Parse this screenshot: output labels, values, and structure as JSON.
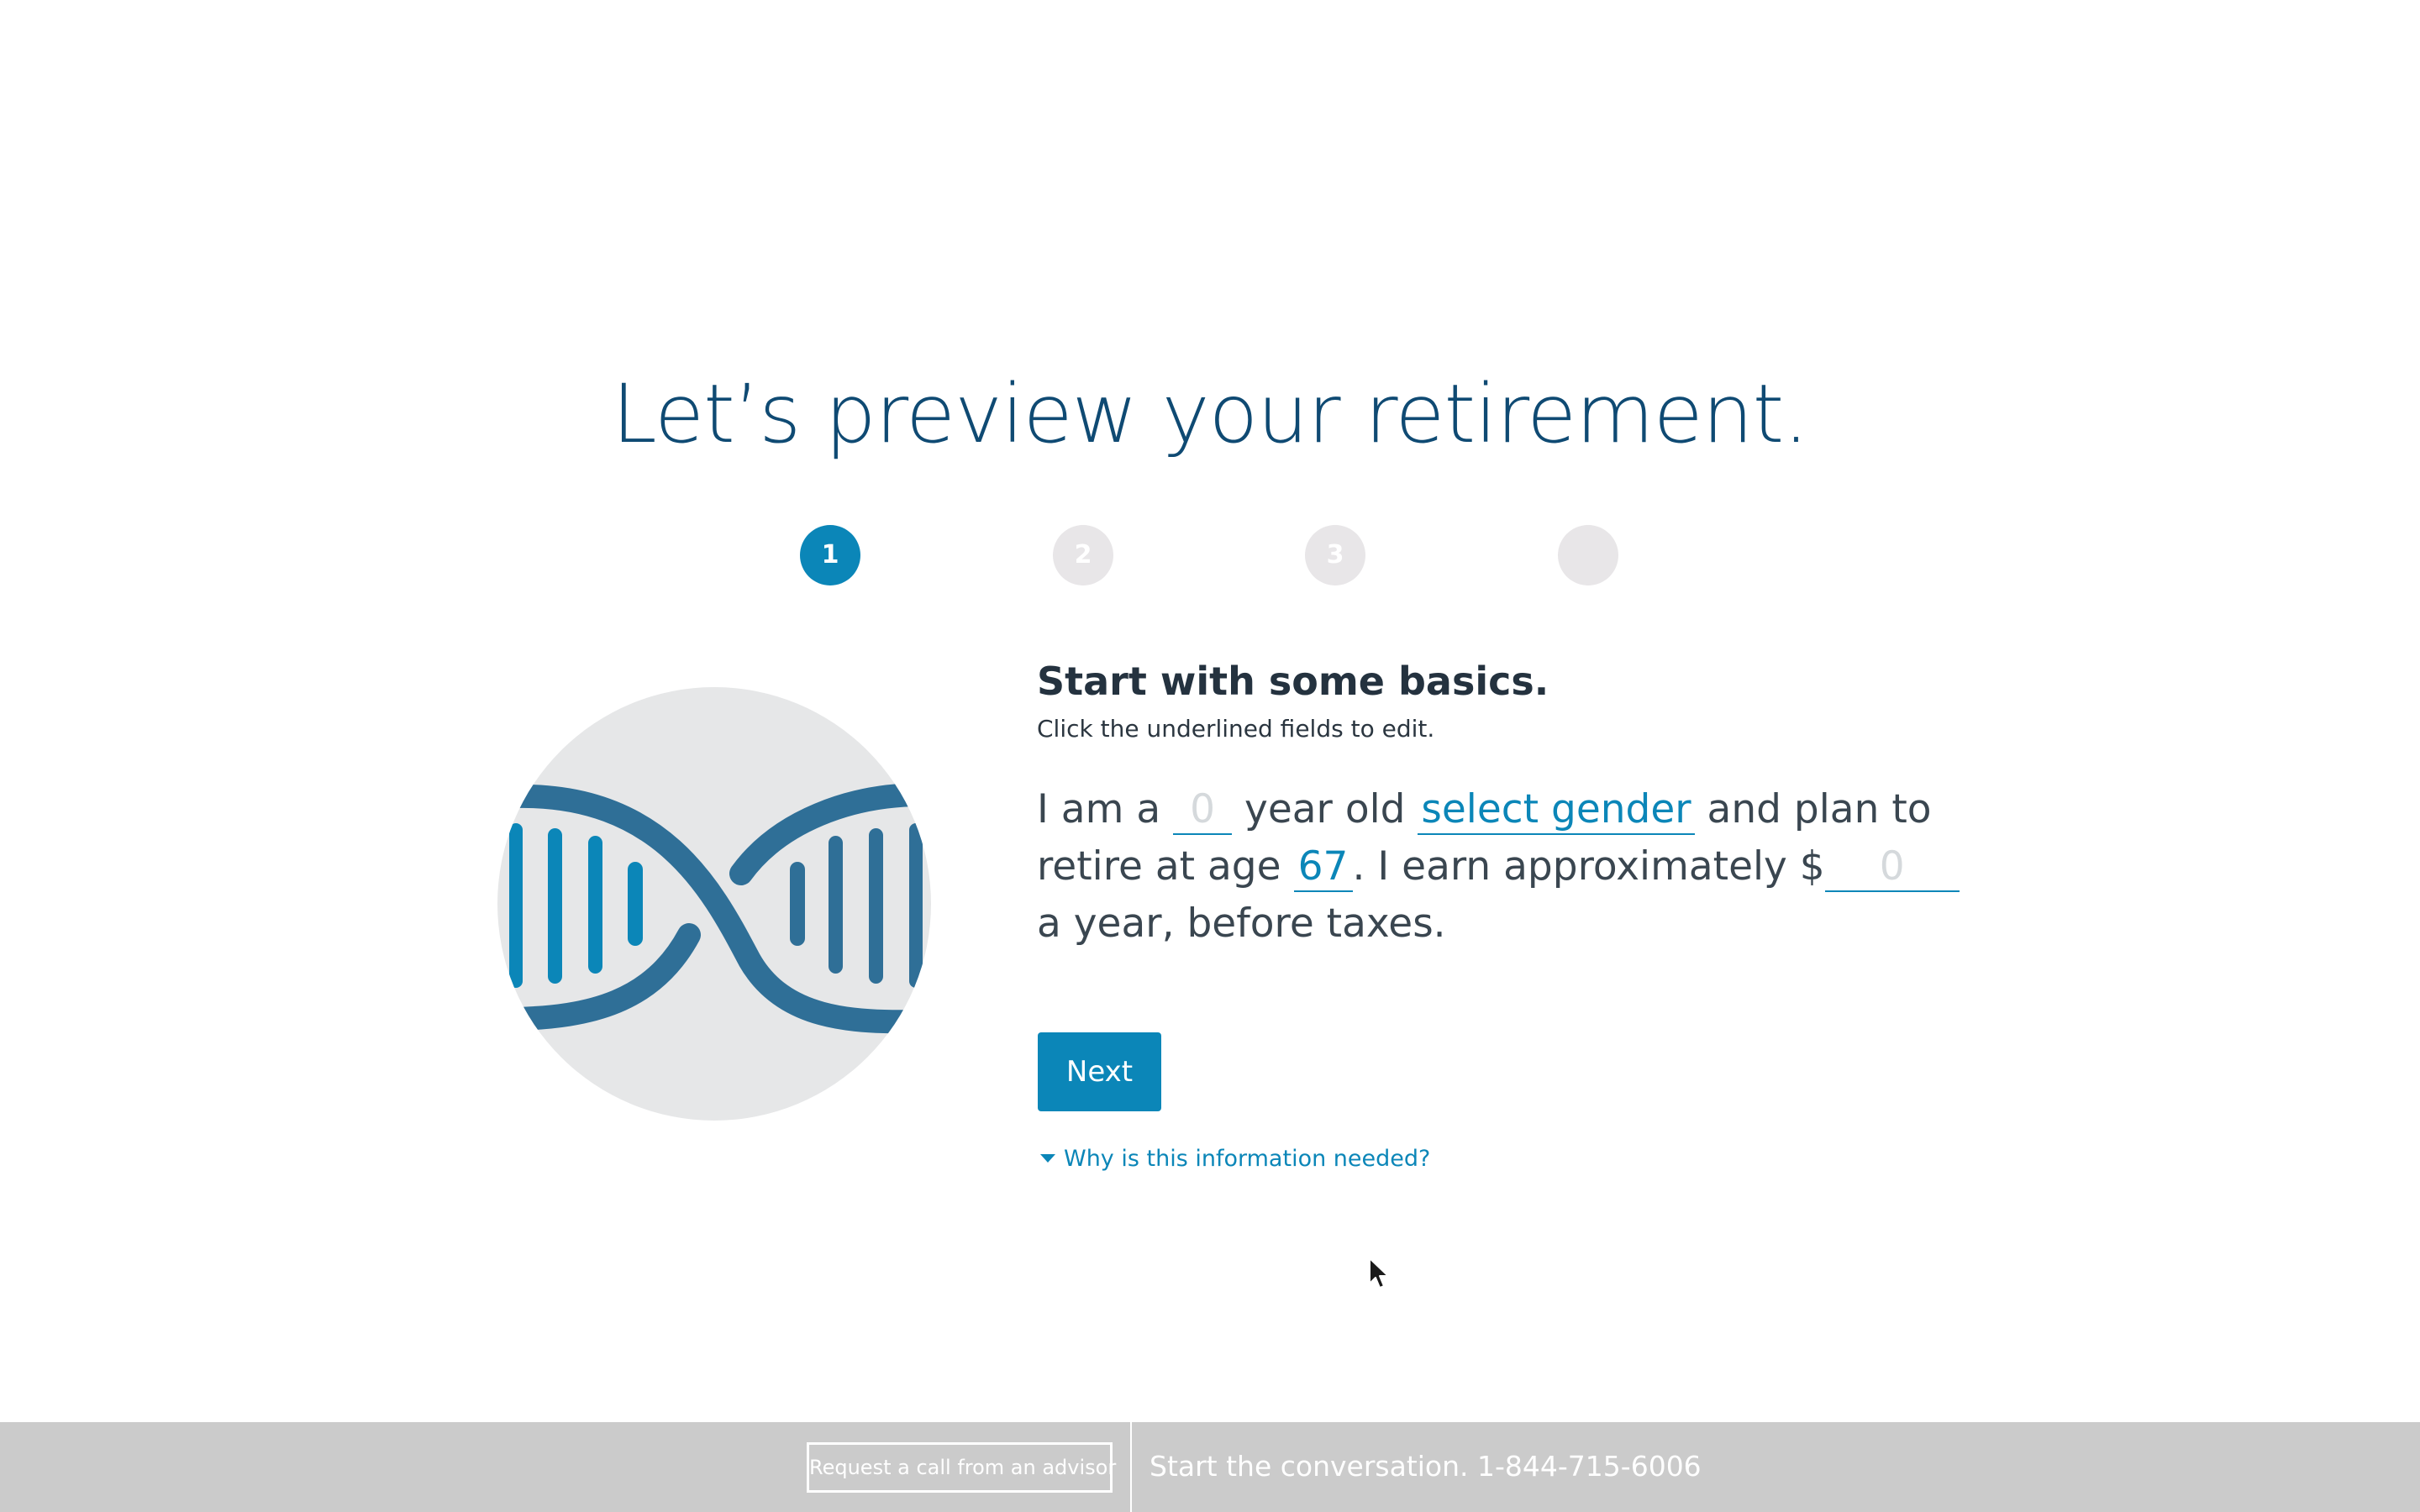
{
  "header": {
    "title": "Let’s preview your retirement."
  },
  "stepper": {
    "steps": [
      {
        "label": "1",
        "active": true
      },
      {
        "label": "2",
        "active": false
      },
      {
        "label": "3",
        "active": false
      },
      {
        "label": "",
        "active": false
      }
    ]
  },
  "illustration": {
    "icon": "dna-icon",
    "colors": {
      "circle": "#e6e7e8",
      "dark_strand": "#2f6f97",
      "light_strand": "#0b86b8"
    }
  },
  "form": {
    "title": "Start with some basics.",
    "subtitle": "Click the underlined fields to edit.",
    "text_1": "I am a ",
    "age_value": "0",
    "text_2": " year old ",
    "gender_value": "select gender",
    "text_3": " and plan to retire at age ",
    "retire_age_value": "67",
    "text_4": ". I earn approximately $",
    "income_value": "0",
    "text_5": " a year, before taxes.",
    "next_label": "Next",
    "why_label": "Why is this information needed?"
  },
  "footer": {
    "call_button_label": "Request a call from an advisor",
    "cta_text": "Start the conversation. 1-844-715-6006"
  },
  "colors": {
    "accent": "#0b86b8",
    "headline": "#0f4a73",
    "footer_bg": "#cbcbcb"
  }
}
